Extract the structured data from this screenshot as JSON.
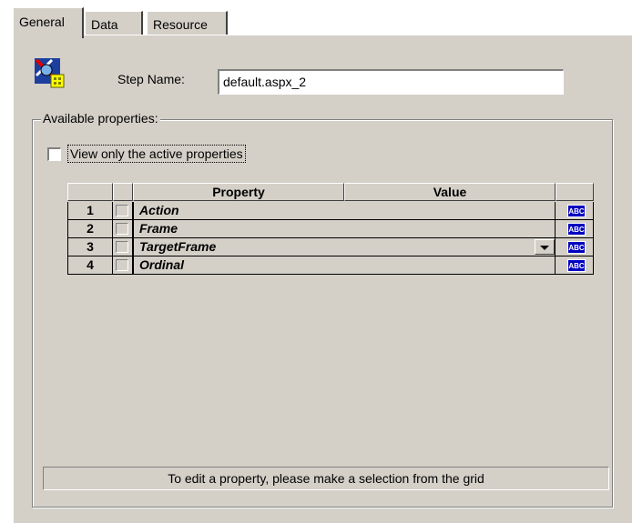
{
  "tabs": [
    {
      "label": "General",
      "active": true
    },
    {
      "label": "Data",
      "active": false
    },
    {
      "label": "Resource",
      "active": false
    }
  ],
  "step": {
    "label": "Step Name:",
    "value": "default.aspx_2",
    "icon": "step-satellite-icon"
  },
  "properties_group": {
    "legend": "Available properties:",
    "checkbox_label": "View only the active properties",
    "checkbox_checked": false
  },
  "grid": {
    "headers": [
      "",
      "",
      "Property",
      "Value",
      ""
    ],
    "rows": [
      {
        "num": "1",
        "property": "Action",
        "value": "",
        "type_icon": "abc-icon",
        "has_dropdown": false
      },
      {
        "num": "2",
        "property": "Frame",
        "value": "",
        "type_icon": "abc-icon",
        "has_dropdown": false
      },
      {
        "num": "3",
        "property": "TargetFrame",
        "value": "",
        "type_icon": "abc-icon",
        "has_dropdown": true
      },
      {
        "num": "4",
        "property": "Ordinal",
        "value": "",
        "type_icon": "abc-icon",
        "has_dropdown": false
      }
    ],
    "type_icon_text": "ABC"
  },
  "status": {
    "text": "To edit a property, please make a selection from the grid"
  },
  "colors": {
    "face": "#d4d0c8",
    "abc_icon_bg": "#0000c0"
  }
}
